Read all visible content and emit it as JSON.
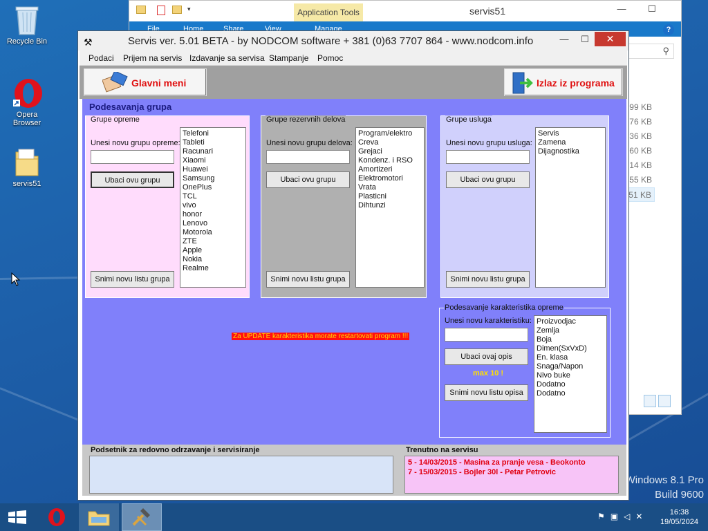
{
  "desktop": {
    "icons": [
      {
        "label": "Recycle Bin"
      },
      {
        "label": "Opera\nBrowser"
      },
      {
        "label": "servis51"
      }
    ],
    "watermark": {
      "line1": "Windows 8.1 Pro",
      "line2": "Build 9600"
    }
  },
  "explorer": {
    "title": "servis51",
    "context_tab": "Application Tools",
    "ribbon_tabs": [
      "File",
      "Home",
      "Share",
      "View",
      "Manage"
    ],
    "sizes": [
      "99 KB",
      "76 KB",
      "36 KB",
      "60 KB",
      "14 KB",
      "55 KB",
      "51 KB"
    ]
  },
  "app": {
    "title": "Servis ver. 5.01 BETA - by NODCOM software  + 381 (0)63 7707 864 - www.nodcom.info",
    "menu": [
      "Podaci",
      "Prijem na servis",
      "Izdavanje sa servisa",
      "Stampanje",
      "Pomoc"
    ],
    "toolbar": {
      "main_menu": "Glavni meni",
      "exit": "Izlaz iz programa"
    },
    "section_title": "Podesavanja grupa",
    "equipment_groups": {
      "title": "Grupe opreme",
      "input_label": "Unesi novu grupu opreme:",
      "insert_button": "Ubaci ovu grupu",
      "save_button": "Snimi novu listu grupa",
      "items": [
        "Telefoni",
        "Tableti",
        "Racunari",
        "Xiaomi",
        "Huawei",
        "Samsung",
        "OnePlus",
        "TCL",
        "vivo",
        "honor",
        "Lenovo",
        "Motorola",
        "ZTE",
        "Apple",
        "Nokia",
        "Realme"
      ]
    },
    "parts_groups": {
      "title": "Grupe rezervnih delova",
      "input_label": "Unesi novu grupu delova:",
      "insert_button": "Ubaci ovu grupu",
      "save_button": "Snimi novu listu grupa",
      "items": [
        "Program/elektro",
        "Creva",
        "Grejaci",
        "Kondenz. i RSO",
        "Amortizeri",
        "Elektromotori",
        "Vrata",
        "Plasticni",
        "Dihtunzi"
      ]
    },
    "service_groups": {
      "title": "Grupe usluga",
      "input_label": "Unesi novu grupu usluga:",
      "insert_button": "Ubaci ovu grupu",
      "save_button": "Snimi novu listu grupa",
      "items": [
        "Servis",
        "Zamena",
        "Dijagnostika"
      ]
    },
    "warning": "Za UPDATE karakteristika morate restartovati program !!!",
    "characteristics": {
      "title": "Podesavanje karakteristika opreme",
      "input_label": "Unesi novu karakteristiku:",
      "insert_button": "Ubaci ovaj opis",
      "max_label": "max 10 !",
      "save_button": "Snimi novu listu opisa",
      "items": [
        "Proizvodjac",
        "Zemlja",
        "Boja",
        "Dimen(SxVxD)",
        "En. klasa",
        "Snaga/Napon",
        "Nivo buke",
        "Dodatno",
        "Dodatno"
      ]
    },
    "reminder": {
      "title": "Podsetnik za redovno odrzavanje i servisiranje"
    },
    "in_service": {
      "title": "Trenutno na servisu",
      "entries": [
        "5 - 14/03/2015 - Masina za pranje vesa - Beokonto",
        "7 - 15/03/2015 - Bojler 30l - Petar Petrovic"
      ]
    }
  },
  "taskbar": {
    "time": "16:38",
    "date": "19/05/2024"
  },
  "colors": {
    "content_bg": "#8080fa",
    "equipment_bg": "#ffdcfc",
    "parts_bg": "#b0b0b0",
    "service_bg": "#d0d0fc",
    "accent_red": "#e01010"
  }
}
